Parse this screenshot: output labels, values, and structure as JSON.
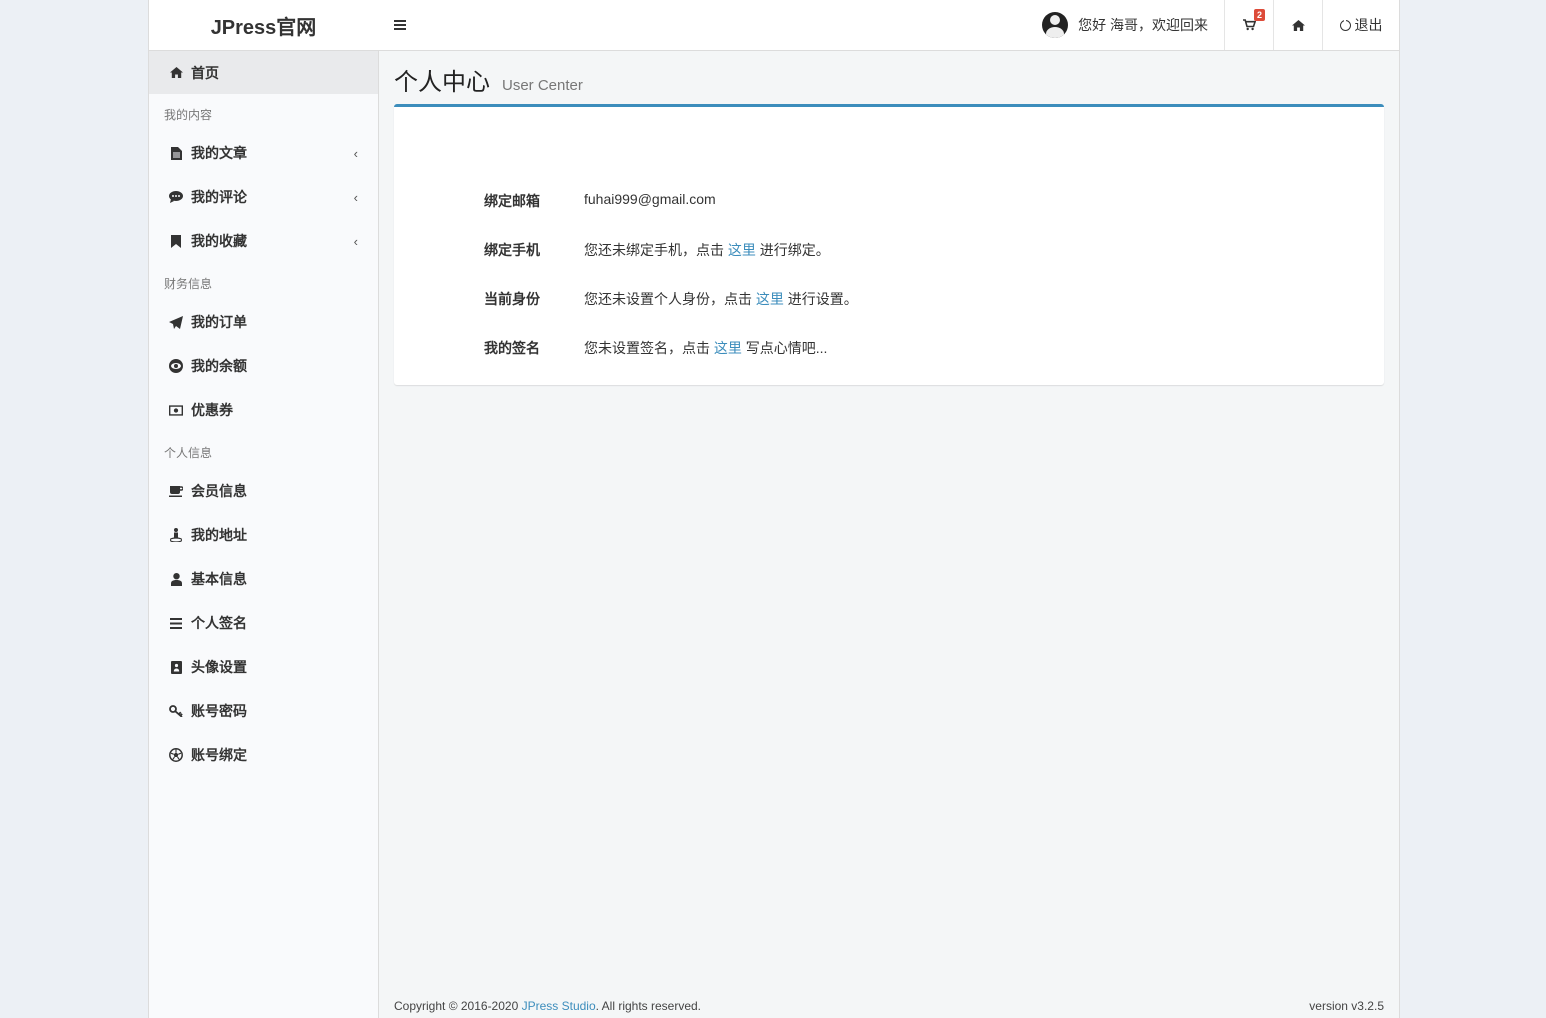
{
  "header": {
    "logo": "JPress官网",
    "greeting": "您好 海哥，欢迎回来",
    "cart_count": "2",
    "logout": "退出"
  },
  "sidebar": {
    "home": "首页",
    "sections": [
      {
        "title": "我的内容",
        "items": [
          {
            "label": "我的文章",
            "icon": "file-text-icon",
            "expandable": true
          },
          {
            "label": "我的评论",
            "icon": "comment-icon",
            "expandable": true
          },
          {
            "label": "我的收藏",
            "icon": "bookmark-icon",
            "expandable": true
          }
        ]
      },
      {
        "title": "财务信息",
        "items": [
          {
            "label": "我的订单",
            "icon": "paper-plane-icon"
          },
          {
            "label": "我的余额",
            "icon": "eye-icon"
          },
          {
            "label": "优惠券",
            "icon": "money-icon"
          }
        ]
      },
      {
        "title": "个人信息",
        "items": [
          {
            "label": "会员信息",
            "icon": "coffee-icon"
          },
          {
            "label": "我的地址",
            "icon": "street-view-icon"
          },
          {
            "label": "基本信息",
            "icon": "user-icon"
          },
          {
            "label": "个人签名",
            "icon": "bars-icon"
          },
          {
            "label": "头像设置",
            "icon": "id-card-icon"
          },
          {
            "label": "账号密码",
            "icon": "key-icon"
          },
          {
            "label": "账号绑定",
            "icon": "soccer-ball-icon"
          }
        ]
      }
    ]
  },
  "page": {
    "title": "个人中心",
    "subtitle": "User Center"
  },
  "info": {
    "email_label": "绑定邮箱",
    "email_value": "fuhai999@gmail.com",
    "phone_label": "绑定手机",
    "phone_before": "您还未绑定手机，点击 ",
    "phone_link": "这里",
    "phone_after": " 进行绑定。",
    "identity_label": "当前身份",
    "identity_before": "您还未设置个人身份，点击 ",
    "identity_link": "这里",
    "identity_after": " 进行设置。",
    "signature_label": "我的签名",
    "signature_before": "您未设置签名，点击 ",
    "signature_link": "这里",
    "signature_after": " 写点心情吧..."
  },
  "footer": {
    "copyright_before": "Copyright © 2016-2020 ",
    "copyright_link": "JPress Studio",
    "copyright_after": ". All rights reserved.",
    "version": "version v3.2.5"
  },
  "colors": {
    "accent": "#3c8dbc",
    "badge": "#dd4b39"
  }
}
